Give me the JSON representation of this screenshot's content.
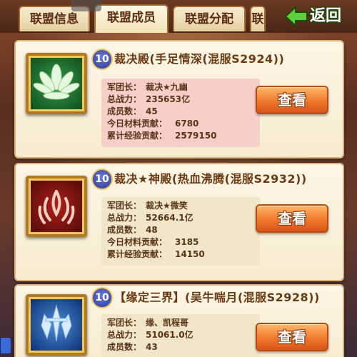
{
  "tabs": [
    {
      "label": "联盟信息",
      "active": false
    },
    {
      "label": "联盟成员",
      "active": true
    },
    {
      "label": "联盟分配",
      "active": false
    },
    {
      "label": "联",
      "active": false
    }
  ],
  "back_label": "返回",
  "stat_labels": {
    "leader": "军团长：",
    "power": "总战力：",
    "members": "成员数：",
    "today_material": "今日材料贡献：",
    "total_exp": "累计经验贡献："
  },
  "view_label": "查看",
  "guilds": [
    {
      "level": "10",
      "name": "裁决殿(手足情深(混服S2924))",
      "leader": "裁决★九幽",
      "power": "235653亿",
      "members": "45",
      "today_material": "6780",
      "total_exp": "2579150",
      "emblem": "lotus-emblem-icon"
    },
    {
      "level": "10",
      "name": "裁决★神殿(热血沸腾(混服S2932))",
      "leader": "裁决★微笑",
      "power": "52664.1亿",
      "members": "48",
      "today_material": "3185",
      "total_exp": "14150",
      "emblem": "flame-emblem-icon"
    },
    {
      "level": "10",
      "name": "【缘定三界】(吴牛喘月(混服S2928))",
      "leader": "缘、凯程哥",
      "power": "51061.0亿",
      "members": "43",
      "emblem": "ice-emblem-icon"
    }
  ],
  "colors": {
    "card_bg": "#fdf6e6",
    "stats_bg": "#f7cfc8",
    "button": "#f0782a",
    "badge": "#2a3a98",
    "title_text": "#6a3a12"
  }
}
